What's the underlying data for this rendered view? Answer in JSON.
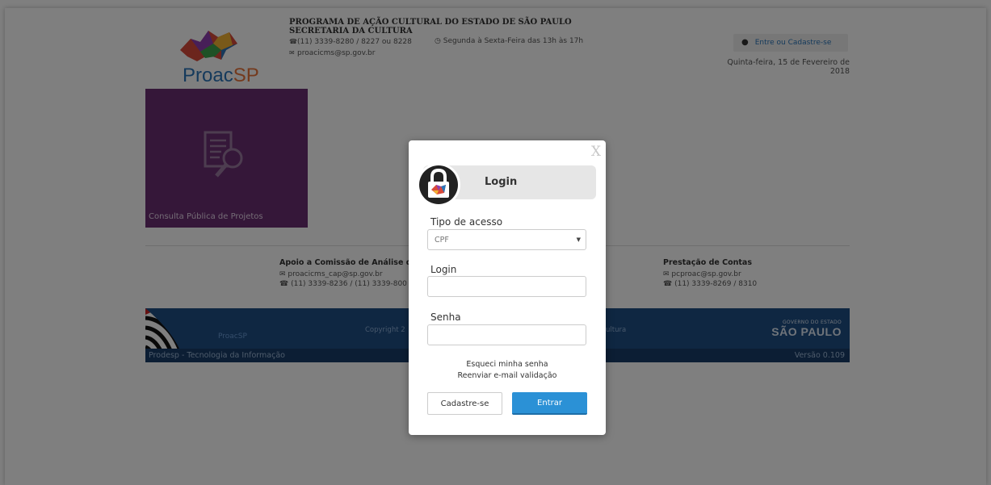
{
  "header": {
    "brand_main": "Proac",
    "brand_suffix": "SP",
    "title_line1": "PROGRAMA DE AÇÃO CULTURAL DO ESTADO DE SÃO PAULO",
    "title_line2": "SECRETARIA DA CULTURA",
    "phone": "(11) 3339-8280 / 8227 ou 8228",
    "hours": "Segunda à Sexta-Feira das 13h às 17h",
    "email": "proacicms@sp.gov.br",
    "login_button": "Entre ou Cadastre-se",
    "date": "Quinta-feira, 15 de Fevereiro de 2018"
  },
  "tile": {
    "label": "Consulta Pública de Projetos",
    "color": "#6b2e72"
  },
  "contacts": {
    "analysis": {
      "title": "Apoio a Comissão de Análise de",
      "email": "proacicms_cap@sp.gov.br",
      "phone": "(11) 3339-8236 / (11) 3339-800"
    },
    "accounts": {
      "title": "Prestação de Contas",
      "email": "pcproac@sp.gov.br",
      "phone": "(11) 3339-8269 / 8310"
    }
  },
  "footer": {
    "mini_logo": "ProacSP",
    "copyright": "Copyright 2",
    "culture_fragment": "ultura",
    "gov_small": "GOVERNO DO ESTADO",
    "gov_big": "SÃO PAULO",
    "provider": "Prodesp - Tecnologia da Informação",
    "version": "Versão 0.109",
    "color": "#1f4e85"
  },
  "modal": {
    "close": "X",
    "title": "Login",
    "access_type_label": "Tipo de acesso",
    "access_type_value": "CPF",
    "login_label": "Login",
    "login_value": "",
    "password_label": "Senha",
    "password_value": "",
    "forgot": "Esqueci minha senha",
    "resend": "Reenviar e-mail validação",
    "register_button": "Cadastre-se",
    "submit_button": "Entrar",
    "accent": "#2b91d6"
  }
}
